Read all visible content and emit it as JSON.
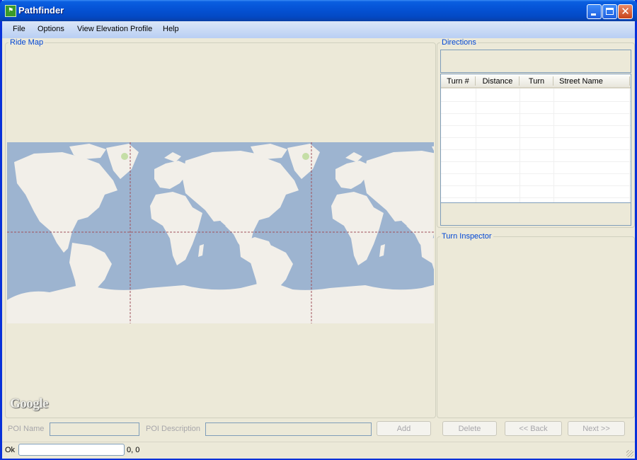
{
  "window": {
    "title": "Pathfinder",
    "icon": "app-map-icon"
  },
  "menu": [
    "File",
    "Options",
    "View Elevation Profile",
    "Help"
  ],
  "ride_map": {
    "title": "Ride Map",
    "logo": "Google"
  },
  "directions": {
    "title": "Directions",
    "columns": [
      "Turn #",
      "Distance",
      "Turn",
      "Street Name"
    ],
    "rows": []
  },
  "turn_inspector": {
    "title": "Turn Inspector"
  },
  "poi": {
    "name_label": "POI Name",
    "name_value": "",
    "description_label": "POI Description",
    "description_value": "",
    "add_label": "Add"
  },
  "nav": {
    "delete_label": "Delete",
    "back_label": "<< Back",
    "next_label": "Next >>"
  },
  "status": {
    "text": "Ok",
    "field_value": "",
    "coords": "0, 0"
  },
  "colors": {
    "ocean": "#9db4d0",
    "land": "#f2efe9",
    "vegetation": "#c5dea6",
    "accent": "#0046d5",
    "date_line": "#a0505a"
  }
}
